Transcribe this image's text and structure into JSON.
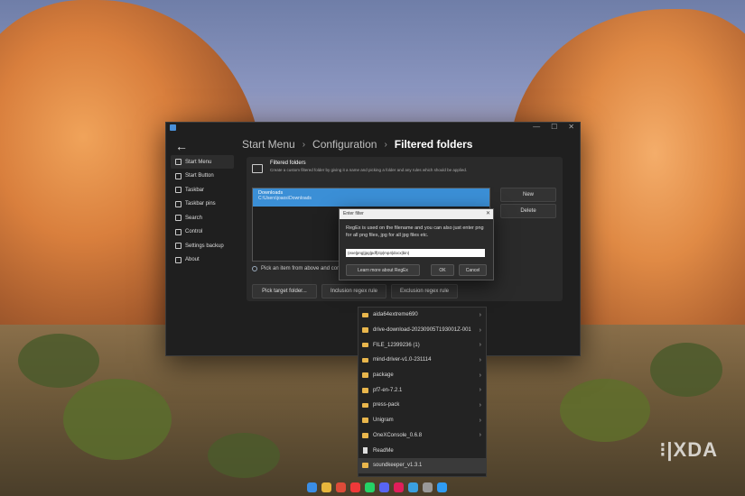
{
  "window": {
    "controls": [
      "—",
      "☐",
      "✕"
    ],
    "breadcrumb": [
      "Start Menu",
      "Configuration",
      "Filtered folders"
    ],
    "back_icon": "arrow-left-icon"
  },
  "sidebar": {
    "items": [
      {
        "label": "Start Menu",
        "icon": "start-menu-icon"
      },
      {
        "label": "Start Button",
        "icon": "start-button-icon"
      },
      {
        "label": "Taskbar",
        "icon": "taskbar-icon"
      },
      {
        "label": "Taskbar pins",
        "icon": "pin-icon"
      },
      {
        "label": "Search",
        "icon": "search-icon"
      },
      {
        "label": "Control",
        "icon": "control-icon"
      },
      {
        "label": "Settings backup",
        "icon": "backup-icon"
      },
      {
        "label": "About",
        "icon": "info-icon"
      }
    ]
  },
  "panel": {
    "title": "Filtered folders",
    "subtitle": "Create a custom filtered folder by giving it a name and picking a folder and any rules which should be applied.",
    "list": [
      {
        "name": "Downloads",
        "path": "C:\\Users\\joaos\\Downloads"
      }
    ],
    "new_button": "New",
    "delete_button": "Delete",
    "info_text": "Pick an item from above and config",
    "pick_button": "Pick target folder...",
    "inclusion_button": "Inclusion regex rule",
    "exclusion_button": "Exclusion regex rule"
  },
  "dialog": {
    "title": "Enter filter",
    "close": "✕",
    "message": "RegEx is used on the filename and you can also just enter png for all png files, jpg for all jpg files etc.",
    "input_value": "(exe|png|jpg|pdf|zip|mp4|docx|bin)",
    "learn_button": "Learn more about RegEx",
    "ok_button": "OK",
    "cancel_button": "Cancel"
  },
  "menu": {
    "items": [
      {
        "label": "aida64extreme690",
        "type": "folder",
        "chevron": "›"
      },
      {
        "label": "drive-download-20230905T193001Z-001",
        "type": "folder",
        "chevron": "›"
      },
      {
        "label": "FILE_12399236 (1)",
        "type": "folder",
        "chevron": "›"
      },
      {
        "label": "mind-driver-v1.0-231114",
        "type": "folder",
        "chevron": "›"
      },
      {
        "label": "package",
        "type": "folder",
        "chevron": "›"
      },
      {
        "label": "pf7-en-7.2.1",
        "type": "folder",
        "chevron": "›"
      },
      {
        "label": "press-pack",
        "type": "folder",
        "chevron": "›"
      },
      {
        "label": "Unigram",
        "type": "folder",
        "chevron": "›"
      },
      {
        "label": "OneXConsole_0.6.8",
        "type": "folder",
        "chevron": "›"
      },
      {
        "label": "ReadMe",
        "type": "document",
        "chevron": ""
      },
      {
        "label": "soundkeeper_v1.3.1",
        "type": "folder",
        "chevron": ""
      }
    ],
    "highlighted_index": 10
  },
  "watermark": "XDA",
  "taskbar": {
    "icons": [
      {
        "name": "windows-start-icon",
        "color": "#3a8ee6"
      },
      {
        "name": "file-explorer-icon",
        "color": "#e7b63c"
      },
      {
        "name": "chrome-icon",
        "color": "#dd4b39"
      },
      {
        "name": "vivaldi-icon",
        "color": "#ef3939"
      },
      {
        "name": "whatsapp-icon",
        "color": "#25d366"
      },
      {
        "name": "discord-icon",
        "color": "#5865f2"
      },
      {
        "name": "slack-icon",
        "color": "#e01e5a"
      },
      {
        "name": "photos-icon",
        "color": "#3aa0e0"
      },
      {
        "name": "settings-icon",
        "color": "#999999"
      },
      {
        "name": "store-icon",
        "color": "#2f9cf4"
      }
    ]
  }
}
